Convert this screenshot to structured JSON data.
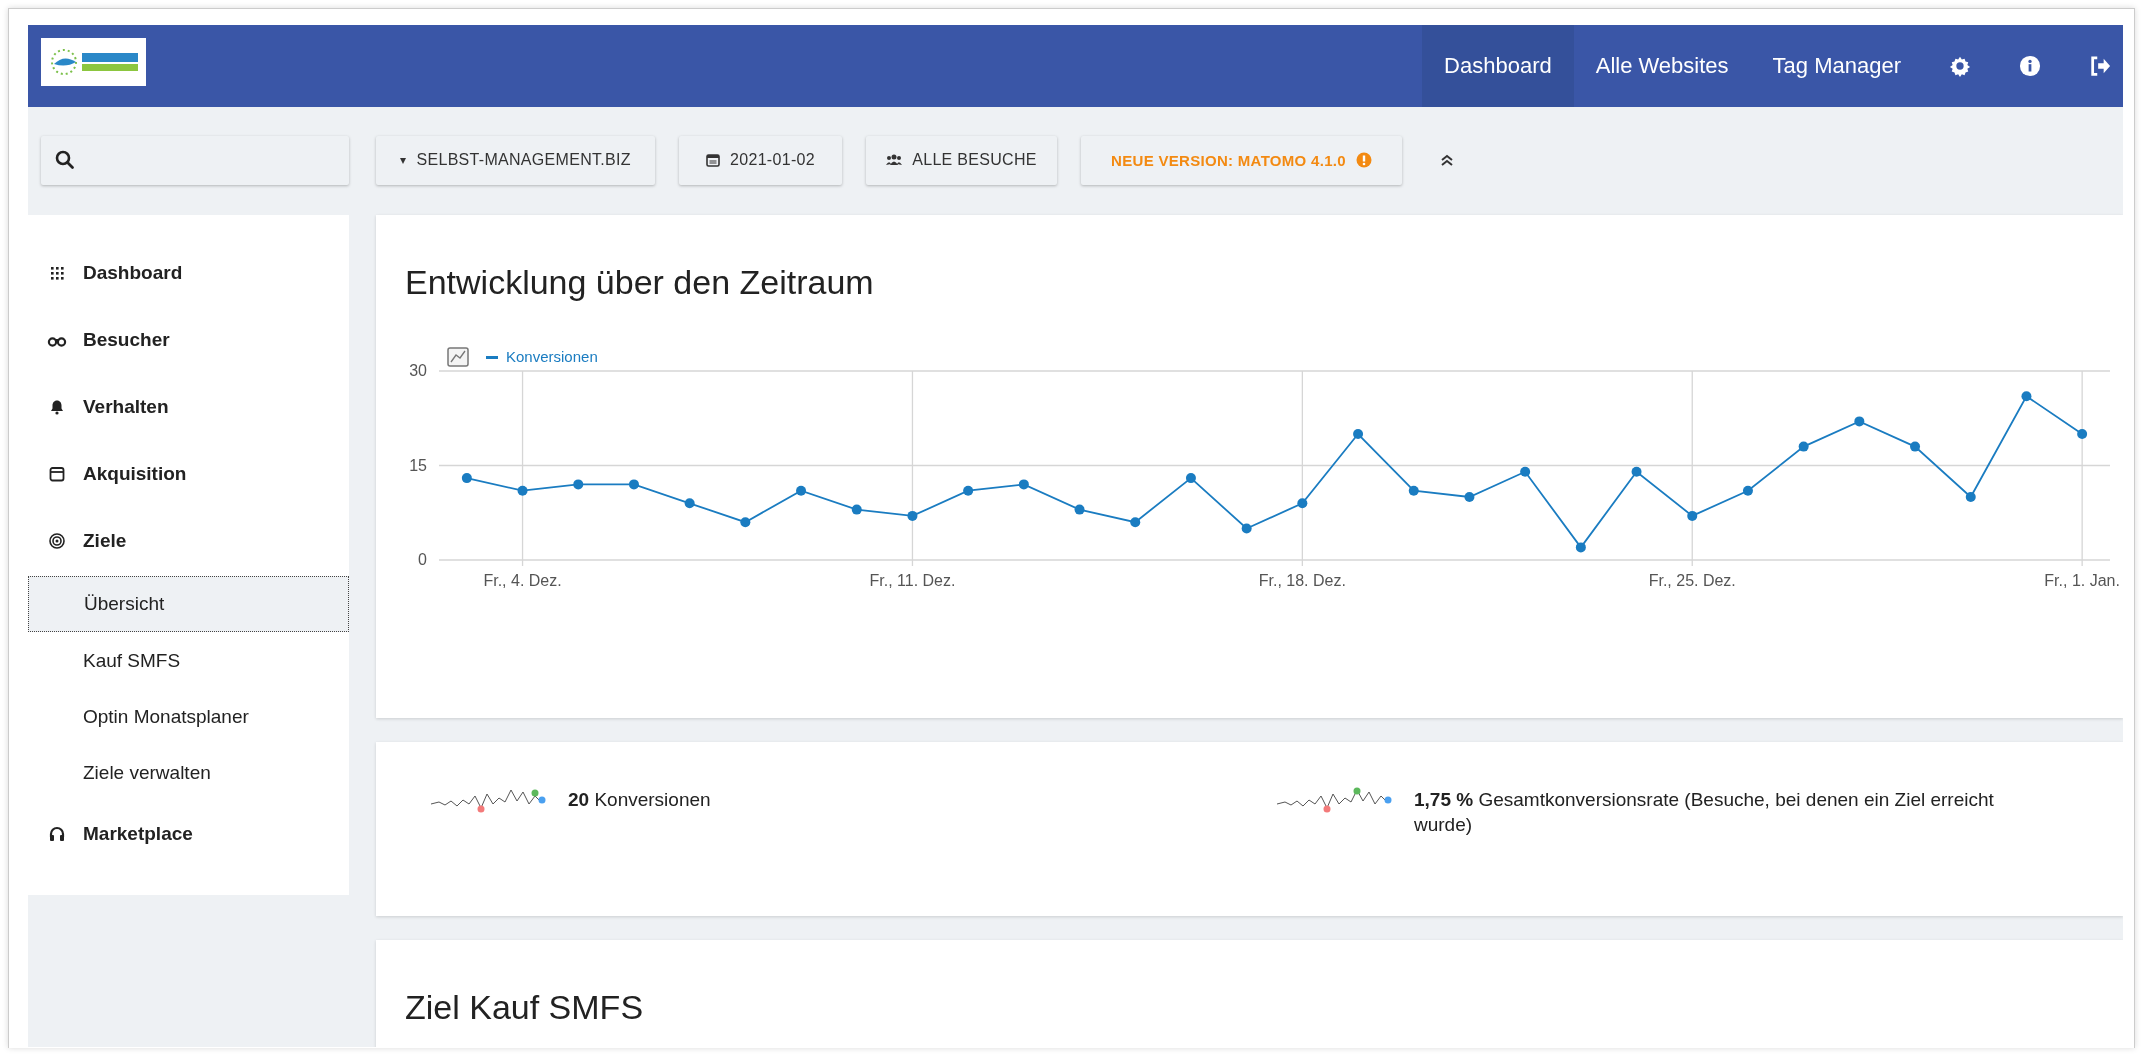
{
  "header": {
    "nav": [
      {
        "label": "Dashboard",
        "selected": true
      },
      {
        "label": "Alle Websites",
        "selected": false
      },
      {
        "label": "Tag Manager",
        "selected": false
      }
    ],
    "icons": [
      {
        "kind": "settings"
      },
      {
        "kind": "info"
      },
      {
        "kind": "logout"
      }
    ]
  },
  "toolbar": {
    "site_marker": "▾",
    "site": "SELBST-MANAGEMENT.BIZ",
    "date": "2021-01-02",
    "segment": "ALLE BESUCHE",
    "update": "NEUE VERSION: MATOMO 4.1.0"
  },
  "sidebar": {
    "items": [
      {
        "label": "Dashboard"
      },
      {
        "label": "Besucher"
      },
      {
        "label": "Verhalten"
      },
      {
        "label": "Akquisition"
      },
      {
        "label": "Ziele",
        "children": [
          {
            "label": "Übersicht",
            "selected": true
          },
          {
            "label": "Kauf SMFS",
            "selected": false
          },
          {
            "label": "Optin Monatsplaner",
            "selected": false
          },
          {
            "label": "Ziele verwalten",
            "selected": false
          }
        ]
      },
      {
        "label": "Marketplace"
      }
    ]
  },
  "evolution": {
    "title": "Entwicklung über den Zeitraum",
    "chart_data": {
      "type": "line",
      "categories": [
        null,
        "Fr., 4. Dez.",
        null,
        null,
        null,
        null,
        null,
        null,
        "Fr., 11. Dez.",
        null,
        null,
        null,
        null,
        null,
        null,
        "Fr., 18. Dez.",
        null,
        null,
        null,
        null,
        null,
        null,
        "Fr., 25. Dez.",
        null,
        null,
        null,
        null,
        null,
        null,
        "Fr., 1. Jan."
      ],
      "series": [
        {
          "name": "Konversionen",
          "color": "#1a7cc1",
          "marker": true,
          "values": [
            13,
            11,
            12,
            12,
            9,
            6,
            11,
            8,
            7,
            11,
            12,
            8,
            6,
            13,
            5,
            9,
            20,
            11,
            10,
            14,
            2,
            14,
            7,
            11,
            18,
            22,
            18,
            10,
            26,
            20
          ]
        }
      ],
      "ylim": [
        0,
        30
      ],
      "yticks": [
        0,
        15,
        30
      ],
      "grid": true
    }
  },
  "sparklines": [
    {
      "value": "20",
      "label": "Konversionen"
    },
    {
      "value": "1,75 %",
      "label": "Gesamtkonversionsrate (Besuche, bei denen ein Ziel erreicht wurde)"
    }
  ],
  "goal": {
    "title": "Ziel Kauf SMFS"
  }
}
